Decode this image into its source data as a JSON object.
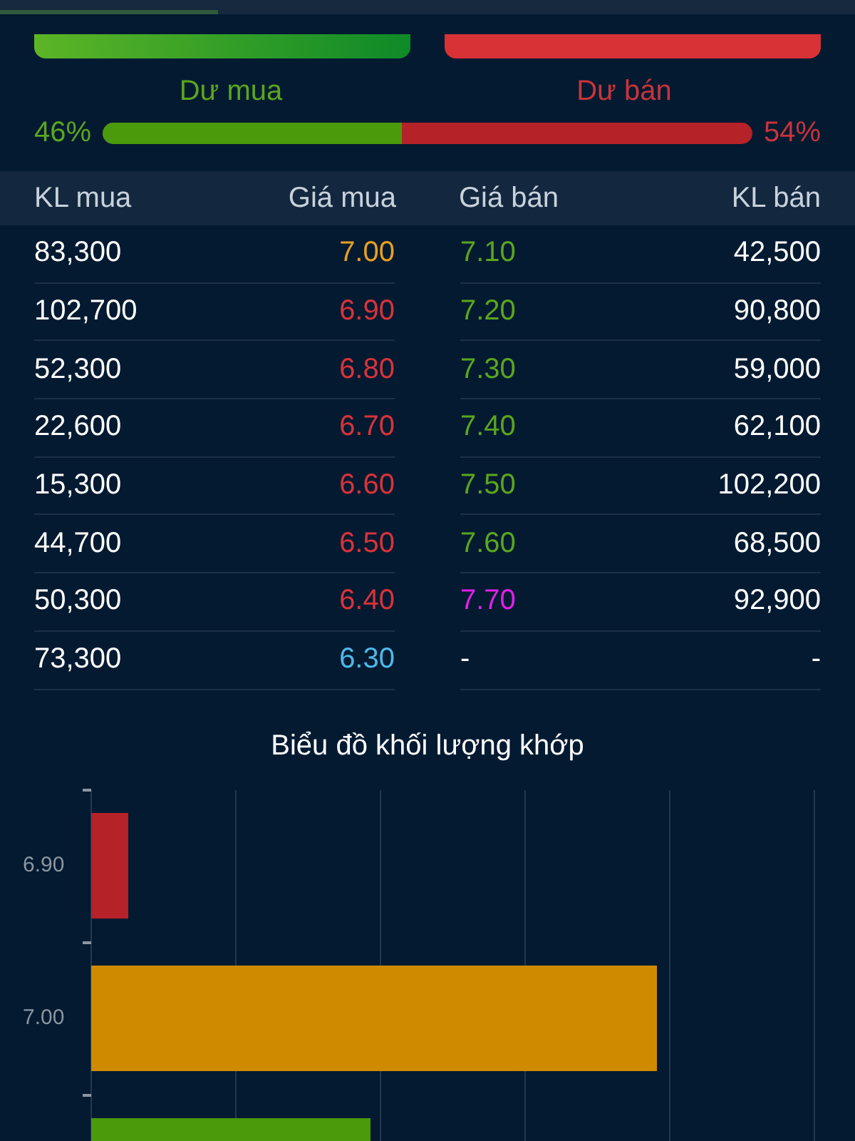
{
  "balance": {
    "buy_label": "Dư mua",
    "sell_label": "Dư bán",
    "buy_percent": "46%",
    "sell_percent": "54%",
    "level": 0.46
  },
  "order_book": {
    "columns": [
      "KL mua",
      "Giá mua",
      "Giá bán",
      "KL bán"
    ],
    "rows": [
      {
        "buy_volume": "83,300",
        "buy_price": {
          "text": "7.00",
          "color": "#e8a020"
        },
        "sell_price": {
          "text": "7.10",
          "color": "#5aa61e"
        },
        "sell_volume": "42,500"
      },
      {
        "buy_volume": "102,700",
        "buy_price": {
          "text": "6.90",
          "color": "#d8333a"
        },
        "sell_price": {
          "text": "7.20",
          "color": "#5aa61e"
        },
        "sell_volume": "90,800"
      },
      {
        "buy_volume": "52,300",
        "buy_price": {
          "text": "6.80",
          "color": "#d8333a"
        },
        "sell_price": {
          "text": "7.30",
          "color": "#5aa61e"
        },
        "sell_volume": "59,000"
      },
      {
        "buy_volume": "22,600",
        "buy_price": {
          "text": "6.70",
          "color": "#d8333a"
        },
        "sell_price": {
          "text": "7.40",
          "color": "#5aa61e"
        },
        "sell_volume": "62,100"
      },
      {
        "buy_volume": "15,300",
        "buy_price": {
          "text": "6.60",
          "color": "#d8333a"
        },
        "sell_price": {
          "text": "7.50",
          "color": "#5aa61e"
        },
        "sell_volume": "102,200"
      },
      {
        "buy_volume": "44,700",
        "buy_price": {
          "text": "6.50",
          "color": "#d8333a"
        },
        "sell_price": {
          "text": "7.60",
          "color": "#5aa61e"
        },
        "sell_volume": "68,500"
      },
      {
        "buy_volume": "50,300",
        "buy_price": {
          "text": "6.40",
          "color": "#d8333a"
        },
        "sell_price": {
          "text": "7.70",
          "color": "#e020e8"
        },
        "sell_volume": "92,900"
      },
      {
        "buy_volume": "73,300",
        "buy_price": {
          "text": "6.30",
          "color": "#4fb8e8"
        },
        "sell_price": {
          "text": "-",
          "color": "#ffffff"
        },
        "sell_volume": "-"
      }
    ]
  },
  "volume_chart": {
    "title": "Biểu đồ khối lượng khớp",
    "bars": [
      {
        "label": "6.90",
        "color": "#b52228"
      },
      {
        "label": "7.00",
        "color": "#d08a00"
      },
      {
        "color": "#4a9a0c"
      }
    ]
  }
}
